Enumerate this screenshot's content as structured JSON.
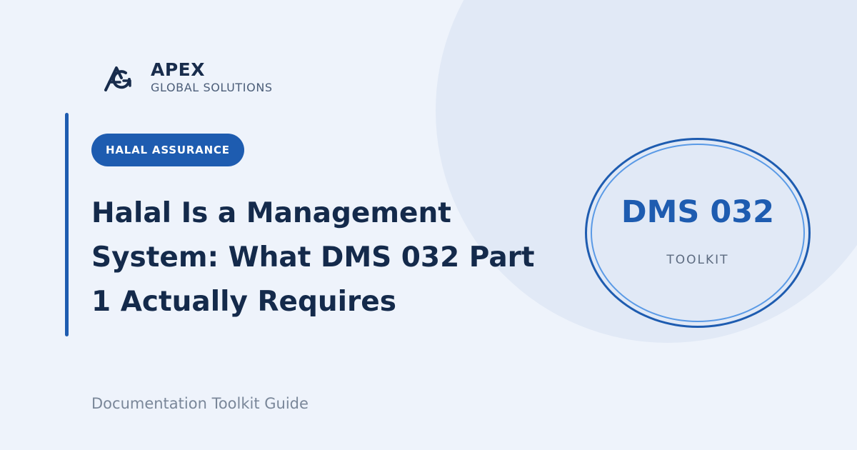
{
  "brand": {
    "name": "APEX",
    "tagline": "GLOBAL SOLUTIONS",
    "logo_icon": "apex-ag-logo-icon"
  },
  "category": {
    "label": "HALAL ASSURANCE"
  },
  "article": {
    "title": "Halal Is a Management System: What DMS 032 Part 1 Actually Requires",
    "subtitle": "Documentation Toolkit Guide"
  },
  "emblem": {
    "code": "DMS 032",
    "label": "TOOLKIT"
  },
  "colors": {
    "background": "#eef3fb",
    "accent": "#1e5cb0",
    "heading": "#142a4b",
    "muted": "#7a8799"
  }
}
